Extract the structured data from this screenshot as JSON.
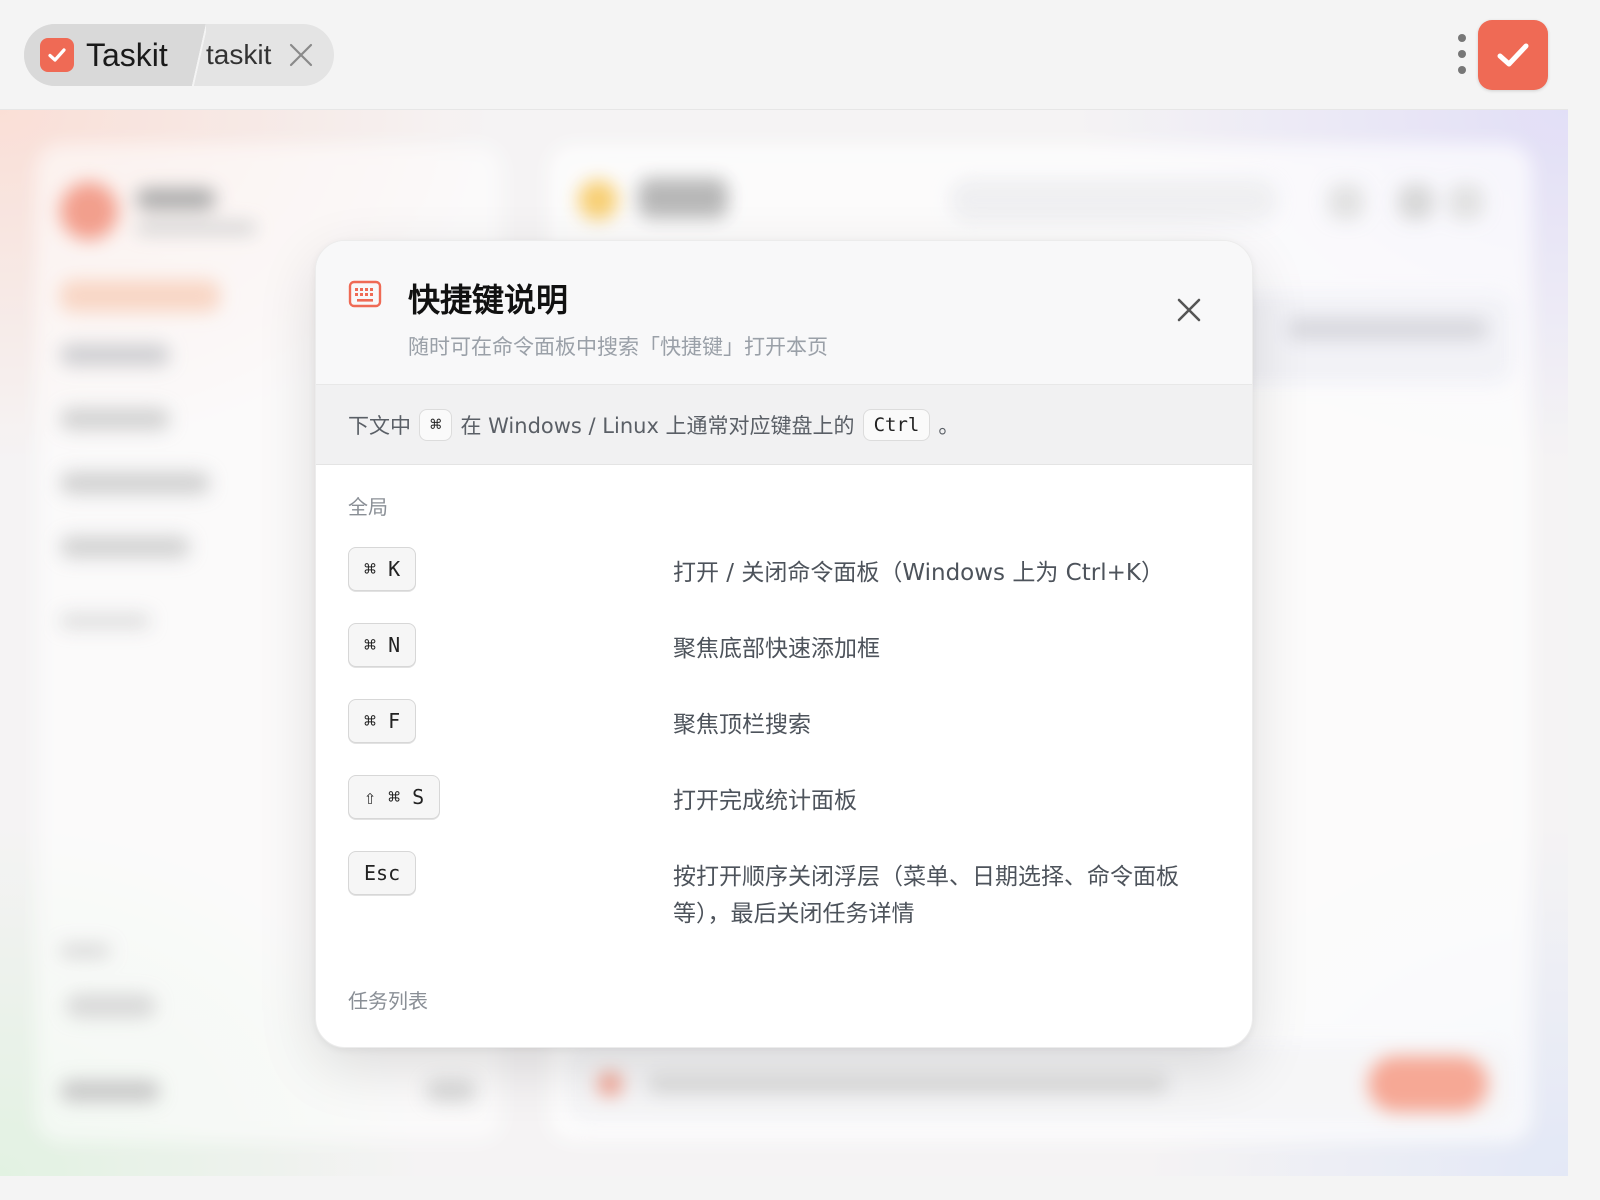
{
  "titlebar": {
    "active_tab": {
      "title": "Taskit",
      "icon": "check-icon"
    },
    "second_tab": {
      "label": "taskit",
      "close_icon": "close-icon"
    },
    "more_icon": "more-vertical-icon",
    "app_button_icon": "check-icon",
    "accent_color": "#ef6a55"
  },
  "modal": {
    "icon": "keyboard-icon",
    "title": "快捷键说明",
    "subtitle": "随时可在命令面板中搜索「快捷键」打开本页",
    "close_icon": "close-icon",
    "note": {
      "prefix": "下文中",
      "key_symbol": "⌘",
      "middle": "在 Windows / Linux 上通常对应键盘上的",
      "ctrl": "Ctrl",
      "suffix": "。"
    },
    "sections": [
      {
        "title": "全局",
        "shortcuts": [
          {
            "keys": "⌘ K",
            "description": "打开 / 关闭命令面板（Windows 上为 Ctrl+K）"
          },
          {
            "keys": "⌘ N",
            "description": "聚焦底部快速添加框"
          },
          {
            "keys": "⌘ F",
            "description": "聚焦顶栏搜索"
          },
          {
            "keys": "⇧ ⌘ S",
            "description": "打开完成统计面板"
          },
          {
            "keys": "Esc",
            "description": "按打开顺序关闭浮层（菜单、日期选择、命令面板等），最后关闭任务详情"
          }
        ]
      },
      {
        "title": "任务列表",
        "shortcuts": []
      }
    ]
  }
}
